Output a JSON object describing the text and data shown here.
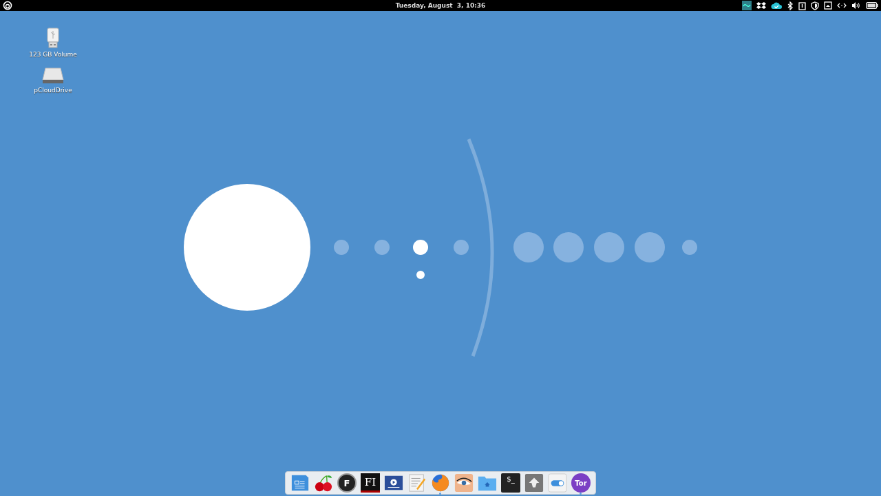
{
  "top_bar": {
    "clock": "Tuesday, August  3, 10:36"
  },
  "desktop_icons": [
    {
      "kind": "usb",
      "label": "123 GB Volume"
    },
    {
      "kind": "drive",
      "label": "pCloudDrive"
    }
  ],
  "dock": [
    {
      "kind": "writer",
      "running": false
    },
    {
      "kind": "cherry",
      "running": false
    },
    {
      "kind": "round-letter",
      "glyph": "F",
      "running": false
    },
    {
      "kind": "dark-letter",
      "glyph": "FI",
      "running": false
    },
    {
      "kind": "video",
      "running": false
    },
    {
      "kind": "notes",
      "running": false
    },
    {
      "kind": "browser",
      "running": true
    },
    {
      "kind": "eye",
      "running": false
    },
    {
      "kind": "home-folder",
      "running": false
    },
    {
      "kind": "terminal",
      "glyph": "$_",
      "running": false
    },
    {
      "kind": "inkscape",
      "running": false
    },
    {
      "kind": "toggle",
      "running": false
    },
    {
      "kind": "tor",
      "glyph": "Tor",
      "running": true
    }
  ]
}
